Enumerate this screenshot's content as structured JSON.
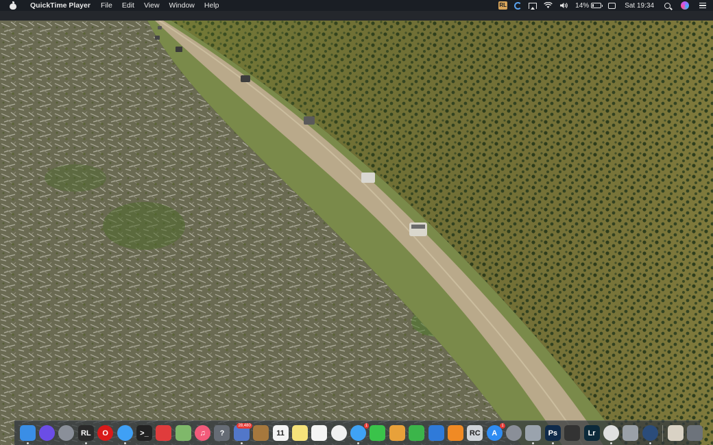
{
  "menubar": {
    "app_name": "QuickTime Player",
    "menus": [
      "File",
      "Edit",
      "View",
      "Window",
      "Help"
    ],
    "battery_percent": "14%",
    "battery_level": 0.14,
    "clock": "Sat 19:34"
  },
  "dock": {
    "items": [
      {
        "name": "finder-icon",
        "label": "",
        "bg": "#3a8ee6"
      },
      {
        "name": "siri-icon",
        "label": "",
        "bg": "#6b4de6"
      },
      {
        "name": "launchpad-icon",
        "label": "",
        "bg": "#8a8f99"
      },
      {
        "name": "rl-app-icon",
        "label": "RL",
        "bg": "#2a2a2a"
      },
      {
        "name": "opera-icon",
        "label": "O",
        "bg": "#d91a1a"
      },
      {
        "name": "safari-icon",
        "label": "",
        "bg": "#3fa0f5"
      },
      {
        "name": "terminal-icon",
        "label": ">_",
        "bg": "#222222"
      },
      {
        "name": "no-entry-app-icon",
        "label": "",
        "bg": "#e03c3c"
      },
      {
        "name": "preview-icon",
        "label": "",
        "bg": "#7fb86a"
      },
      {
        "name": "music-icon",
        "label": "♫",
        "bg": "#f25b7a"
      },
      {
        "name": "help-icon",
        "label": "?",
        "bg": "#666c75"
      },
      {
        "name": "photo-app-icon",
        "label": "",
        "bg": "#5277c9",
        "badge": "28,480"
      },
      {
        "name": "notebook-app-icon",
        "label": "",
        "bg": "#a6783d"
      },
      {
        "name": "calendar-icon",
        "label": "11",
        "bg": "#f4f4f4"
      },
      {
        "name": "notes-icon",
        "label": "",
        "bg": "#f6e27a"
      },
      {
        "name": "reminders-icon",
        "label": "",
        "bg": "#f4f4f4"
      },
      {
        "name": "photos-icon",
        "label": "",
        "bg": "#f0f0f0"
      },
      {
        "name": "messages-icon",
        "label": "",
        "bg": "#3fa2f5",
        "badge": "1"
      },
      {
        "name": "facetime-icon",
        "label": "",
        "bg": "#3ac34a"
      },
      {
        "name": "keynote-doc-icon",
        "label": "",
        "bg": "#e8a13a"
      },
      {
        "name": "numbers-icon",
        "label": "",
        "bg": "#3bb54a"
      },
      {
        "name": "keynote-icon",
        "label": "",
        "bg": "#2f7ad9"
      },
      {
        "name": "books-icon",
        "label": "",
        "bg": "#f08a24"
      },
      {
        "name": "rc-app-icon",
        "label": "RC",
        "bg": "#cfd3d8"
      },
      {
        "name": "app-store-icon",
        "label": "A",
        "bg": "#2f8cf2",
        "badge": "1"
      },
      {
        "name": "system-preferences-icon",
        "label": "",
        "bg": "#8a8f98"
      },
      {
        "name": "screenshot-app-icon",
        "label": "",
        "bg": "#9aa3ad"
      },
      {
        "name": "photoshop-icon",
        "label": "Ps",
        "bg": "#0f2a4a"
      },
      {
        "name": "final-cut-icon",
        "label": "",
        "bg": "#333333"
      },
      {
        "name": "lightroom-icon",
        "label": "Lr",
        "bg": "#0c2a3a"
      },
      {
        "name": "chrome-icon",
        "label": "",
        "bg": "#e0e0e0"
      },
      {
        "name": "document-icon",
        "label": "",
        "bg": "#9aa0a8"
      },
      {
        "name": "browser-app-icon",
        "label": "",
        "bg": "#2b4c7a"
      }
    ],
    "trash": [
      {
        "name": "downloads-stack-icon",
        "label": "",
        "bg": "#d9d2c4"
      },
      {
        "name": "trash-icon",
        "label": "",
        "bg": "#6d737b"
      }
    ]
  }
}
